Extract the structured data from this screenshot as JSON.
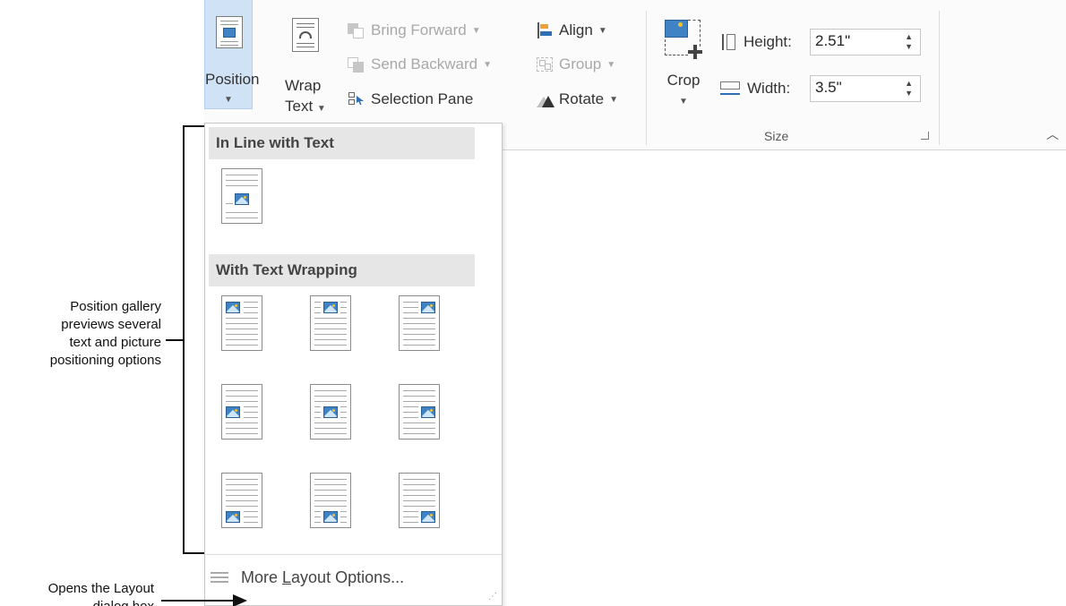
{
  "ribbon": {
    "position_label": "Position",
    "wrap_label_1": "Wrap",
    "wrap_label_2": "Text",
    "bring_forward": "Bring Forward",
    "send_backward": "Send Backward",
    "selection_pane": "Selection Pane",
    "align": "Align",
    "group": "Group",
    "rotate": "Rotate",
    "crop": "Crop",
    "height_label": "Height:",
    "height_value": "2.51\"",
    "width_label": "Width:",
    "width_value": "3.5\"",
    "size_group": "Size"
  },
  "gallery": {
    "inline_header": "In Line with Text",
    "wrapping_header": "With Text Wrapping",
    "more_prefix": "More ",
    "more_hotkey": "L",
    "more_suffix": "ayout Options..."
  },
  "annotations": {
    "gallery_note_1": "Position gallery",
    "gallery_note_2": "previews several",
    "gallery_note_3": "text and picture",
    "gallery_note_4": "positioning options",
    "dialog_note_1": "Opens the Layout",
    "dialog_note_2": "dialog box"
  },
  "icons": {
    "position": "position-icon",
    "wrap_text": "wrap-text-icon",
    "crop": "crop-icon",
    "collapse": "chevron-up-icon"
  },
  "colors": {
    "selected_button": "#cfe2f6",
    "picture_blue": "#3f83c5",
    "sun_yellow": "#f5c22e",
    "header_gray": "#e6e6e6"
  }
}
